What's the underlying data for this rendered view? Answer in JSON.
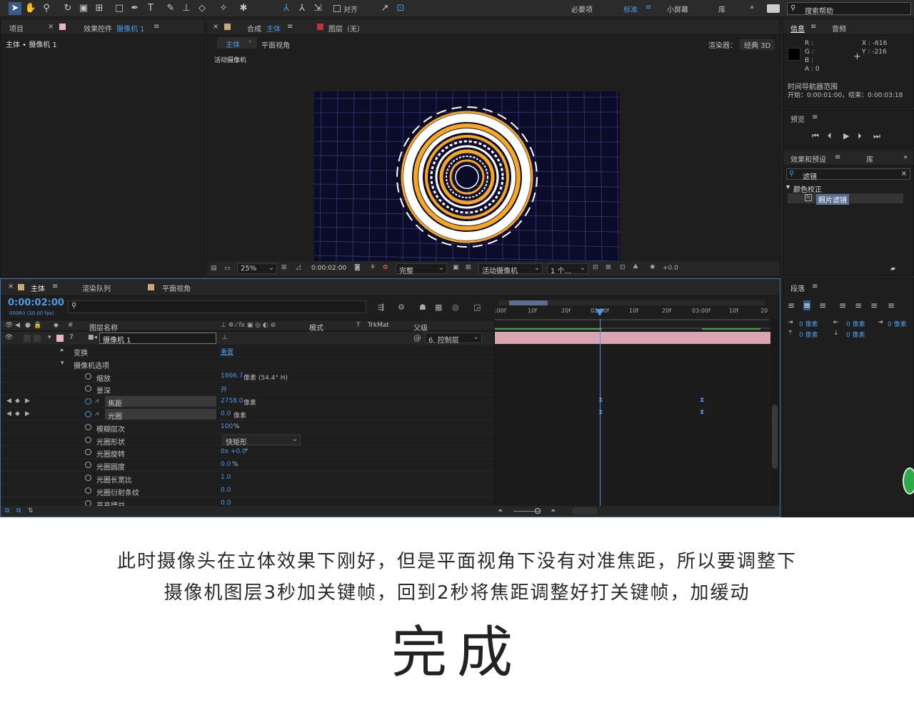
{
  "toolbar": {
    "snap_label": "对齐",
    "workspaces": [
      "必要项",
      "标准",
      "小屏幕",
      "库"
    ],
    "active_workspace": "标准",
    "search_placeholder": "搜索帮助"
  },
  "project_panel": {
    "tab_project": "项目",
    "tab_effects": "效果控件",
    "effects_target": "摄像机 1",
    "header_label": "主体 • 摄像机 1"
  },
  "comp_panel": {
    "tab_comp": "合成",
    "comp_name": "主体",
    "tab_layer": "图层（无）",
    "sub_tab_main": "主体",
    "sub_tab_flat": "平面视角",
    "renderer_label": "渲染器：",
    "renderer_value": "经典 3D",
    "active_camera_label": "活动摄像机",
    "footer": {
      "zoom": "25%",
      "timecode": "0:00:02:00",
      "resolution": "完整",
      "view": "活动摄像机",
      "views_count": "1 个...",
      "exposure": "+0.0"
    }
  },
  "info_panel": {
    "tab_info": "信息",
    "tab_audio": "音频",
    "r": "R :",
    "g": "G :",
    "b": "B :",
    "a": "A : 0",
    "x": "X : -616",
    "y": "Y : -216",
    "nav_title": "时间导航器范围",
    "nav_range": "开始：0:00:01:00，结束：0:00:03:18"
  },
  "preview_panel": {
    "title": "预览"
  },
  "effects_panel": {
    "tab_effects": "效果和预设",
    "tab_lib": "库",
    "search_value": "滤镜",
    "category": "颜色校正",
    "item": "照片滤镜"
  },
  "paragraph_panel": {
    "title": "段落",
    "indent_values": [
      "0 像素",
      "0 像素",
      "0 像素",
      "0 像素",
      "0 像素"
    ]
  },
  "timeline": {
    "tab_main": "主体",
    "tab_render": "渲染队列",
    "tab_flat": "平面视角",
    "timecode": "0:00:02:00",
    "frames": "00060 (30.00 fps)",
    "col_name": "图层名称",
    "col_mode": "模式",
    "col_trkmat": "TrkMat",
    "col_parent": "父级",
    "layer_number": "7",
    "layer_name": "摄像机 1",
    "parent_value": "6. 控制层",
    "ruler_labels": [
      ":00f",
      "10f",
      "20f",
      "02:00f",
      "10f",
      "20f",
      "03:00f",
      "10f",
      "20"
    ],
    "properties": [
      {
        "name": "变换",
        "value": "重置",
        "unit": ""
      },
      {
        "name": "摄像机选项",
        "value": "",
        "unit": ""
      },
      {
        "name": "缩放",
        "value": "1866.7",
        "unit": "像素 (54.4° H)"
      },
      {
        "name": "景深",
        "value": "开",
        "unit": ""
      },
      {
        "name": "焦距",
        "value": "2758.0",
        "unit": "像素"
      },
      {
        "name": "光圈",
        "value": "0.0",
        "unit": "像素"
      },
      {
        "name": "模糊层次",
        "value": "100",
        "unit": "%"
      },
      {
        "name": "光圈形状",
        "value": "快矩形",
        "unit": ""
      },
      {
        "name": "光圈旋转",
        "value": "0x +0.0",
        "unit": "°"
      },
      {
        "name": "光圈圆度",
        "value": "0.0",
        "unit": "%"
      },
      {
        "name": "光圈长宽比",
        "value": "1.0",
        "unit": ""
      },
      {
        "name": "光圈衍射条纹",
        "value": "0.0",
        "unit": ""
      },
      {
        "name": "高亮增益",
        "value": "0.0",
        "unit": ""
      }
    ]
  },
  "caption": {
    "line1": "此时摄像头在立体效果下刚好，但是平面视角下没有对准焦距，所以要调整下",
    "line2": "摄像机图层3秒加关键帧，回到2秒将焦距调整好打关键帧，加缓动",
    "title": "完成"
  },
  "colors": {
    "accent": "#4a9ae6",
    "layer_bar": "#d9a5b3",
    "ring_orange": "#f5a623"
  }
}
